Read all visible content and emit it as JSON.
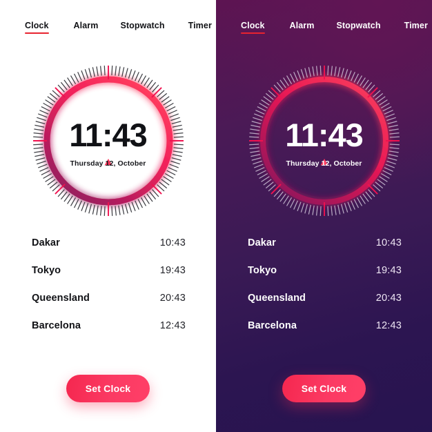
{
  "app": {
    "title": "Clock",
    "theme_names": [
      "light",
      "dark"
    ],
    "accent_color": "#f8294f",
    "underline_color": "#e8232f",
    "ring_gradient": [
      "#ff2f55",
      "#e01050",
      "#8e1257"
    ],
    "dark_bg_gradient": [
      "#5d1452",
      "#3a1a55",
      "#271450"
    ]
  },
  "tabs": [
    {
      "id": "clock",
      "label": "Clock",
      "active": true
    },
    {
      "id": "alarm",
      "label": "Alarm",
      "active": false
    },
    {
      "id": "stopwatch",
      "label": "Stopwatch",
      "active": false
    },
    {
      "id": "timer",
      "label": "Timer",
      "active": false
    }
  ],
  "clock": {
    "time": "11:43",
    "date": "Thursday 12, October",
    "marker": "triangle-up",
    "tick_count": 120,
    "accent_tick_interval": 15
  },
  "cities": [
    {
      "name": "Dakar",
      "time": "10:43"
    },
    {
      "name": "Tokyo",
      "time": "19:43"
    },
    {
      "name": "Queensland",
      "time": "20:43"
    },
    {
      "name": "Barcelona",
      "time": "12:43"
    }
  ],
  "button": {
    "label": "Set Clock"
  }
}
